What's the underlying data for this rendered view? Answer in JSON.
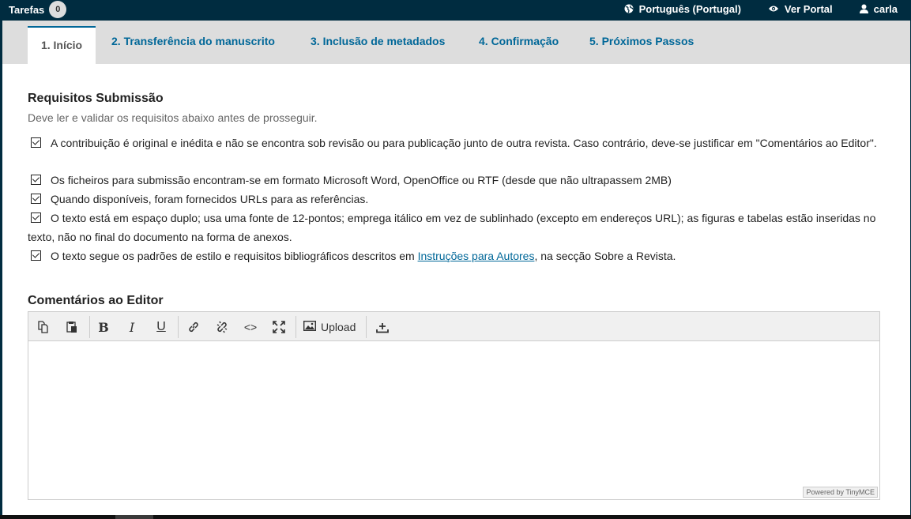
{
  "topbar": {
    "tasks_label": "Tarefas",
    "tasks_count": "0",
    "language": "Português (Portugal)",
    "view_site": "Ver Portal",
    "user": "carla"
  },
  "tabs": [
    {
      "label": "1. Início"
    },
    {
      "label": "2. Transferência do manuscrito"
    },
    {
      "label": "3. Inclusão de metadados"
    },
    {
      "label": "4. Confirmação"
    },
    {
      "label": "5. Próximos Passos"
    }
  ],
  "requirements": {
    "title": "Requisitos Submissão",
    "description": "Deve ler e validar os requisitos abaixo antes de prosseguir.",
    "items": [
      {
        "text": "A contribuição é original e inédita e não se encontra sob revisão ou para publicação junto de outra revista. Caso contrário, deve-se justificar em \"Comentários ao Editor\".",
        "checked": true
      },
      {
        "text": "Os ficheiros para submissão encontram-se em formato Microsoft Word, OpenOffice ou RTF (desde que não ultrapassem 2MB)",
        "checked": true
      },
      {
        "text": "Quando disponíveis, foram fornecidos URLs para as referências.",
        "checked": true
      },
      {
        "text": "O texto está em espaço duplo; usa uma fonte de 12-pontos; emprega itálico em vez de sublinhado (excepto em endereços URL); as figuras e tabelas estão inseridas no texto, não no final do documento na forma de anexos.",
        "checked": true
      },
      {
        "text_before": "O texto segue os padrões de estilo e requisitos bibliográficos descritos em ",
        "link": "Instruções para Autores",
        "text_after": ", na secção Sobre a Revista.",
        "checked": true
      }
    ]
  },
  "comments": {
    "title": "Comentários ao Editor",
    "upload_label": "Upload",
    "powered_by": "Powered by TinyMCE",
    "value": ""
  },
  "colors": {
    "header_bg": "#002c40",
    "accent": "#006798",
    "tab_bar_bg": "#dddddd"
  }
}
